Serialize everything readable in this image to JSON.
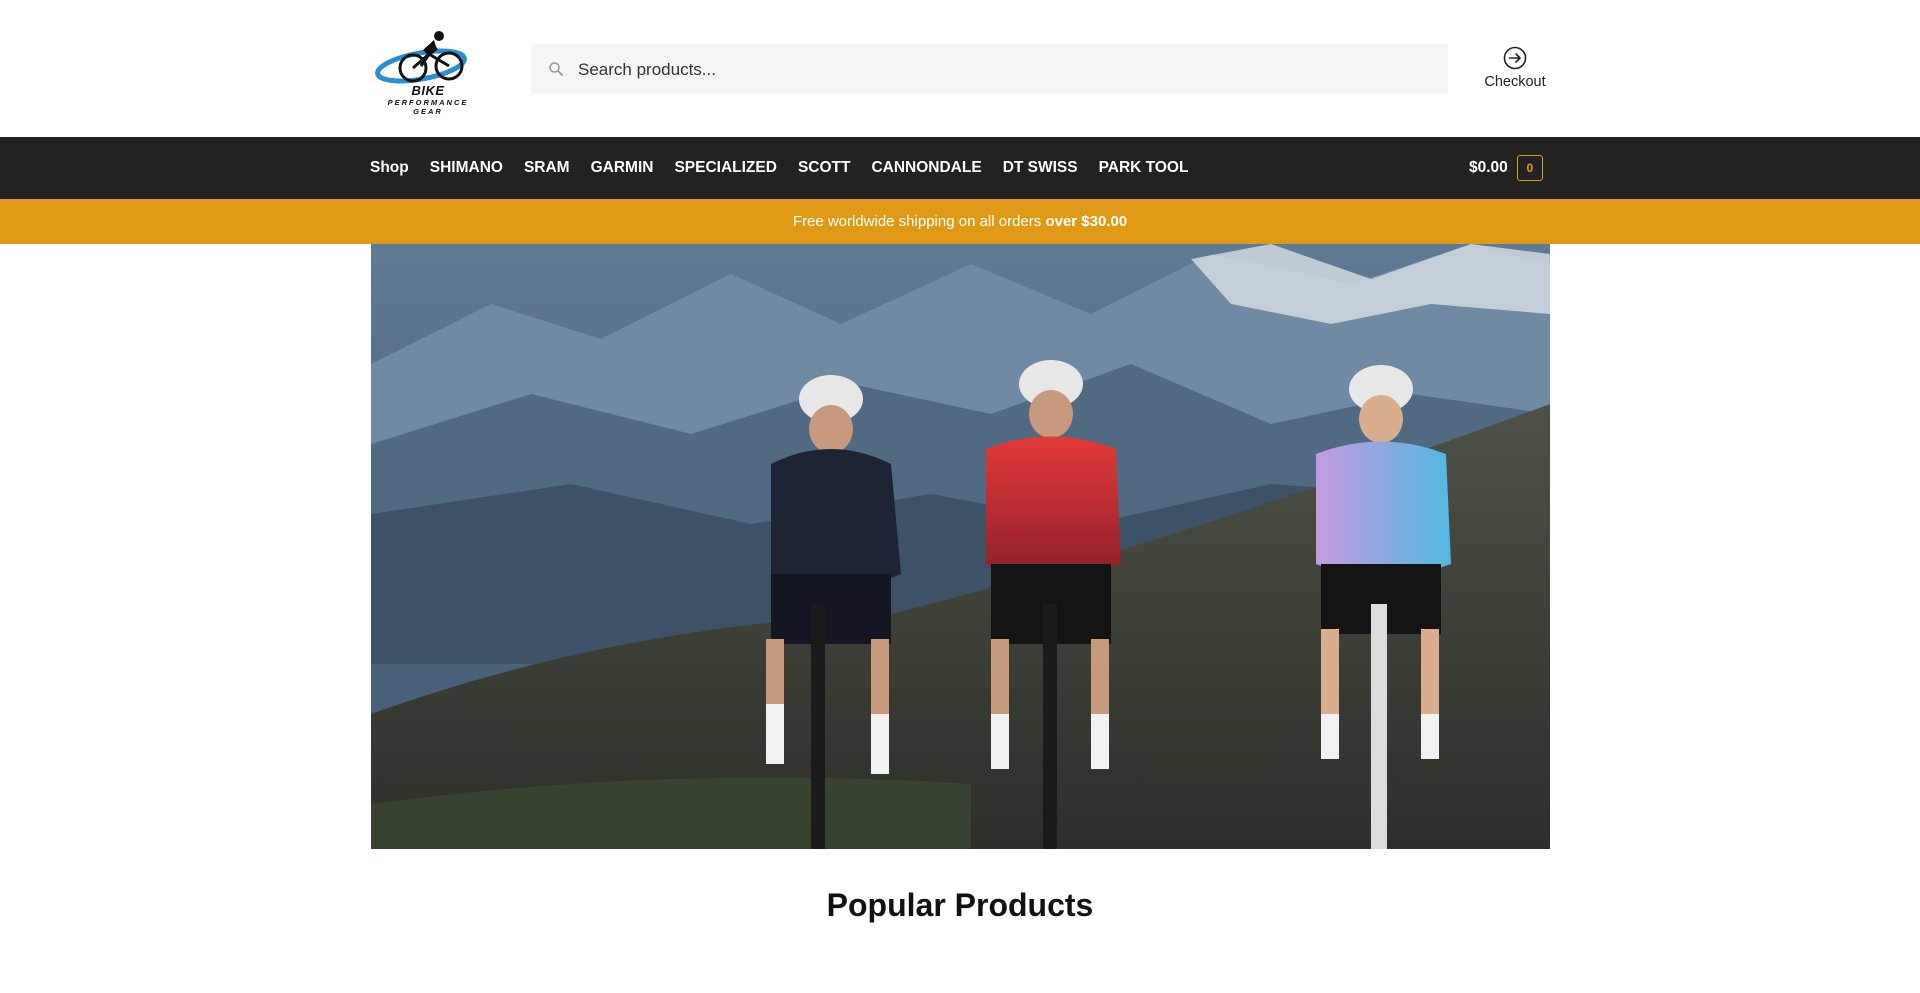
{
  "brand": {
    "logo_main": "BIKE",
    "logo_sub": "PERFORMANCE GEAR"
  },
  "search": {
    "placeholder": "Search products...",
    "value": ""
  },
  "header": {
    "checkout_label": "Checkout"
  },
  "nav": {
    "items": [
      {
        "label": "Shop"
      },
      {
        "label": "SHIMANO"
      },
      {
        "label": "SRAM"
      },
      {
        "label": "GARMIN"
      },
      {
        "label": "SPECIALIZED"
      },
      {
        "label": "SCOTT"
      },
      {
        "label": "CANNONDALE"
      },
      {
        "label": "DT SWISS"
      },
      {
        "label": "PARK TOOL"
      }
    ],
    "cart_total": "$0.00",
    "cart_count": "0"
  },
  "promo": {
    "text": "Free worldwide shipping on all orders ",
    "emphasis": "over $30.00"
  },
  "main": {
    "section_title": "Popular Products"
  },
  "colors": {
    "nav_background": "#222222",
    "accent": "#df9914",
    "search_background": "#f5f5f5"
  },
  "icons": {
    "search": "search-icon",
    "checkout": "arrow-right-circle-icon"
  }
}
